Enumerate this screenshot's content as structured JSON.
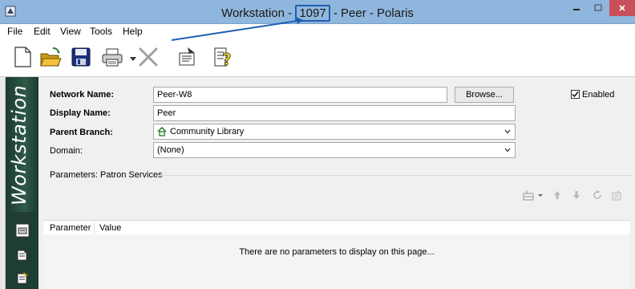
{
  "window": {
    "title_prefix": "Workstation - ",
    "title_id": "1097",
    "title_suffix": " - Peer - Polaris",
    "icons": {
      "app": "polaris-app-icon",
      "minimize": "minimize-icon",
      "maximize": "maximize-icon",
      "close": "close-icon"
    }
  },
  "menu": {
    "items": [
      {
        "label": "File"
      },
      {
        "label": "Edit"
      },
      {
        "label": "View"
      },
      {
        "label": "Tools"
      },
      {
        "label": "Help"
      }
    ]
  },
  "toolbar": {
    "buttons": [
      {
        "icon": "new-document-icon"
      },
      {
        "icon": "open-folder-icon"
      },
      {
        "icon": "save-disk-icon"
      },
      {
        "icon": "print-icon"
      },
      {
        "icon": "dropdown-arrow-icon"
      },
      {
        "icon": "delete-x-icon"
      },
      {
        "icon": "properties-icon"
      },
      {
        "icon": "help-icon"
      }
    ]
  },
  "sidebar": {
    "title": "Workstation",
    "icons": [
      "workstation-icon",
      "edit-form-icon",
      "edit-form-alt-icon"
    ]
  },
  "form": {
    "network_name_label": "Network Name:",
    "network_name_value": "Peer-W8",
    "browse_label": "Browse...",
    "enabled_label": "Enabled",
    "enabled_checked": true,
    "display_name_label": "Display Name:",
    "display_name_value": "Peer",
    "parent_branch_label": "Parent Branch:",
    "parent_branch_value": "Community Library",
    "domain_label": "Domain:",
    "domain_value": "(None)"
  },
  "parameters": {
    "section_title": "Parameters: Patron Services",
    "toolbar_icons": [
      "insert-row-icon",
      "dropdown-icon",
      "move-up-icon",
      "move-down-icon",
      "refresh-icon",
      "properties-icon"
    ],
    "columns": [
      "Parameter",
      "Value"
    ],
    "empty_message": "There are no parameters to display on this page..."
  },
  "colors": {
    "titlebar": "#8fb6dc",
    "close_button": "#c7505a",
    "sidebar": "#1e3d33",
    "annotation_arrow": "#1f5fb2"
  }
}
